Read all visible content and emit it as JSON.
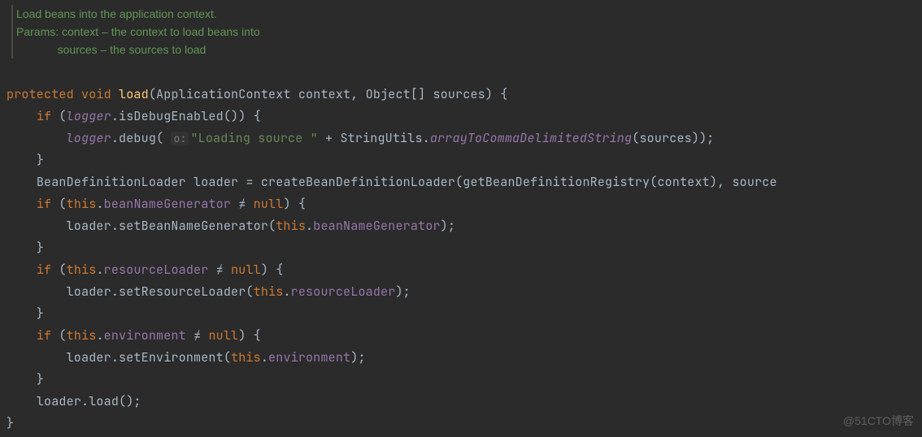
{
  "javadoc": {
    "summary": "Load beans into the application context.",
    "params_label": "Params:",
    "param1": " context – the context to load beans into",
    "param2": "             sources – the sources to load"
  },
  "tokens": {
    "protected": "protected",
    "void": "void",
    "if": "if",
    "this": "this",
    "null": "null",
    "neq": "≠",
    "load": "load",
    "ApplicationContext": "ApplicationContext",
    "context": "context",
    "Object": "Object",
    "sources": "sources",
    "logger": "logger",
    "isDebugEnabled": "isDebugEnabled",
    "debug": "debug",
    "hint_o": "o:",
    "loading_str": "\"Loading source \"",
    "StringUtils": "StringUtils",
    "arrayToCommaDelimitedString": "arrayToCommaDelimitedString",
    "BeanDefinitionLoader": "BeanDefinitionLoader",
    "loader": "loader",
    "createBeanDefinitionLoader": "createBeanDefinitionLoader",
    "getBeanDefinitionRegistry": "getBeanDefinitionRegistry",
    "source_trail": "source",
    "beanNameGenerator": "beanNameGenerator",
    "setBeanNameGenerator": "setBeanNameGenerator",
    "resourceLoader": "resourceLoader",
    "setResourceLoader": "setResourceLoader",
    "environment": "environment",
    "setEnvironment": "setEnvironment",
    "loadCall": "load"
  },
  "watermark": "@51CTO博客"
}
